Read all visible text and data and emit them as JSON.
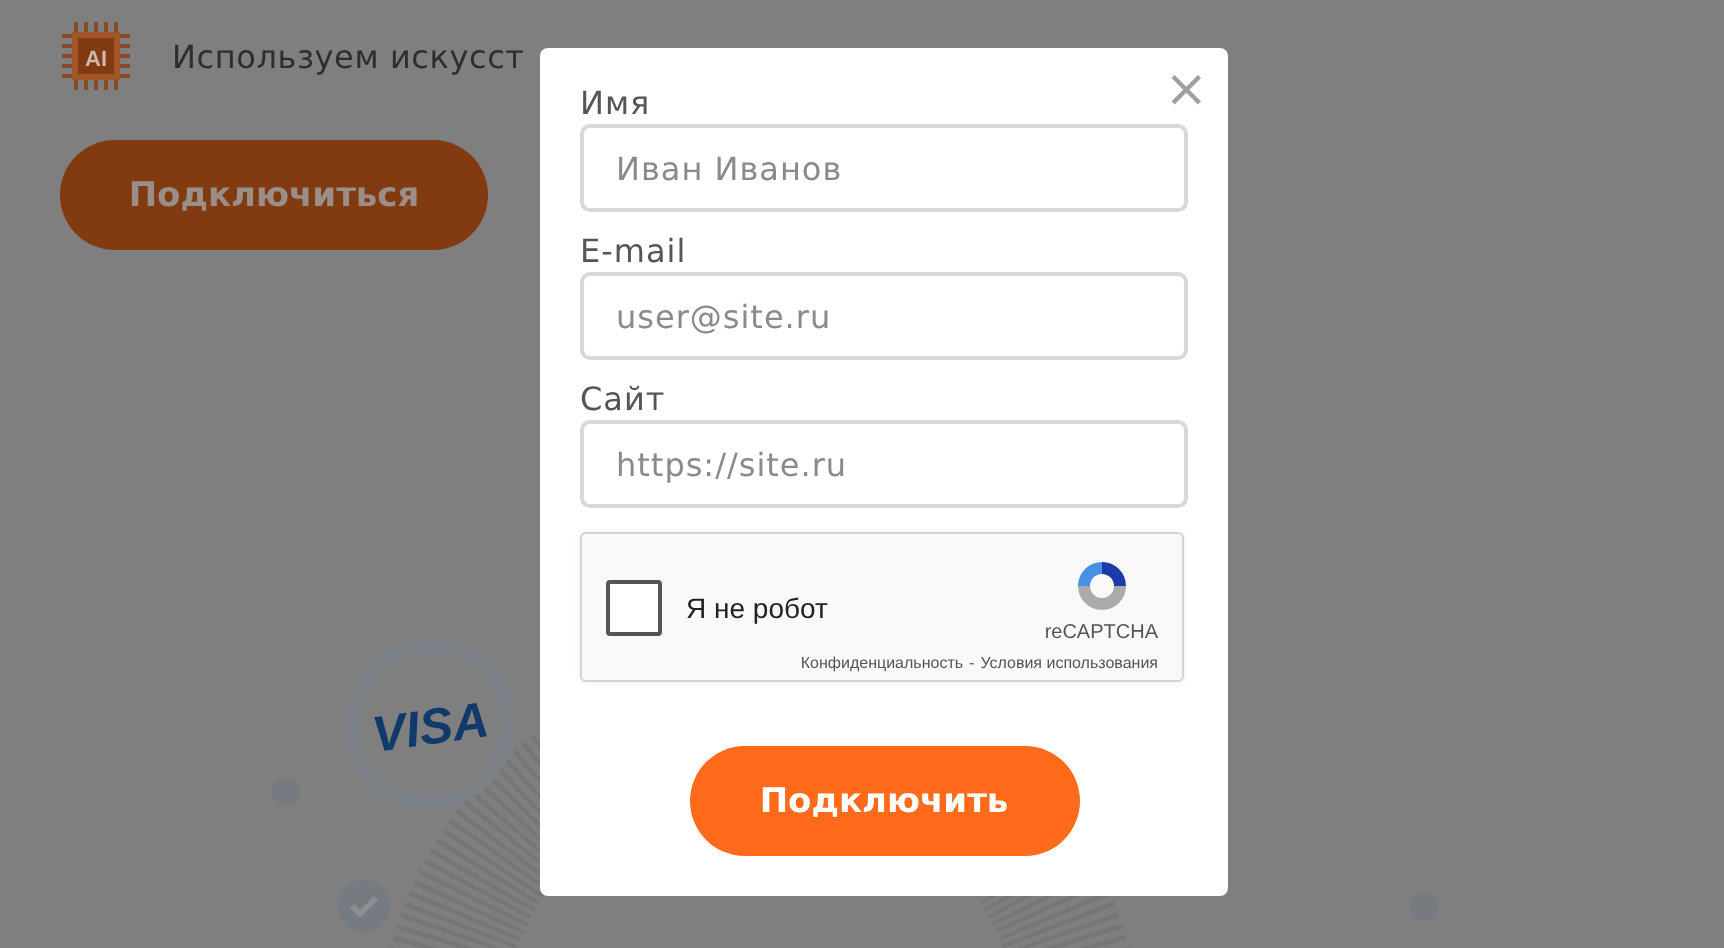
{
  "background": {
    "logo_text": "AI",
    "heading": "Используем искусст",
    "connect_button": "Подключиться",
    "card_logo": "VISA"
  },
  "modal": {
    "close": "×",
    "fields": [
      {
        "label": "Имя",
        "placeholder": "Иван Иванов"
      },
      {
        "label": "E-mail",
        "placeholder": "user@site.ru"
      },
      {
        "label": "Сайт",
        "placeholder": "https://site.ru"
      }
    ],
    "captcha": {
      "label": "Я не робот",
      "checked": false,
      "brand": "reCAPTCHA",
      "privacy_link": "Конфиденциальность",
      "separator": "-",
      "terms_link": "Условия использования"
    },
    "submit_button": "Подключить"
  }
}
